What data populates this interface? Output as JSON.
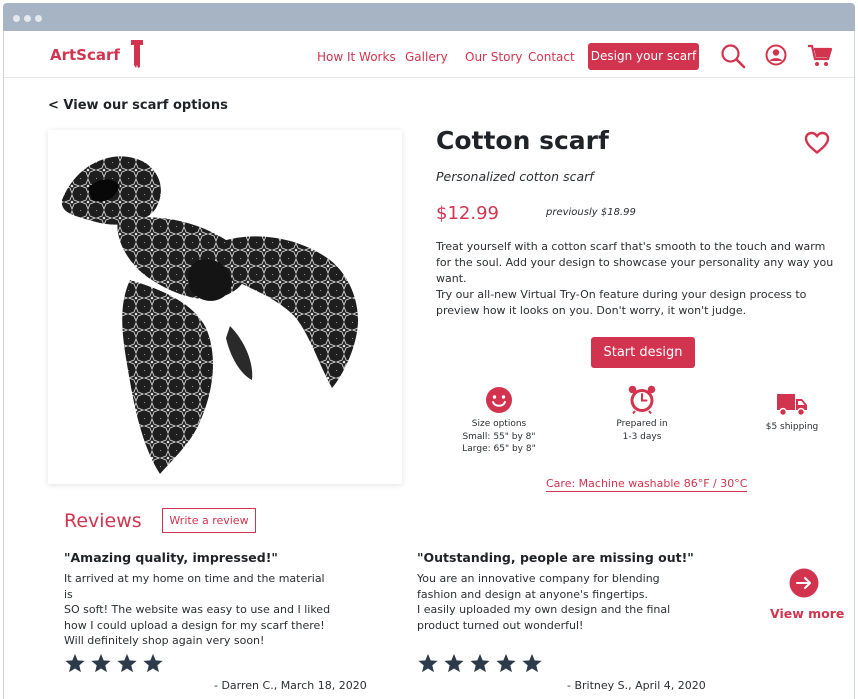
{
  "brand": {
    "name": "ArtScarf",
    "accent": "#d2344f"
  },
  "nav": {
    "links": [
      "How It Works",
      "Gallery",
      "Our Story",
      "Contact"
    ],
    "cta": "Design your scarf"
  },
  "back_link": "< View our scarf options",
  "product": {
    "title": "Cotton scarf",
    "subtitle": "Personalized cotton scarf",
    "price": "$12.99",
    "previous_price": "previously $18.99",
    "description_1": "Treat yourself with a cotton scarf that's smooth to the touch and warm for the soul. Add your design to showcase your personality any way you want.",
    "description_2": "Try our all-new Virtual Try-On feature during your design process to preview how it looks on you. Don't worry, it won't judge.",
    "start_button": "Start design",
    "features": [
      {
        "icon": "smile-icon",
        "lines": [
          "Size options",
          "Small: 55\" by 8\"",
          "Large: 65\" by 8\""
        ]
      },
      {
        "icon": "alarm-clock-icon",
        "lines": [
          "Prepared in",
          "1-3 days"
        ]
      },
      {
        "icon": "truck-icon",
        "lines": [
          "$5 shipping"
        ]
      }
    ],
    "care": "Care: Machine washable 86°F / 30°C"
  },
  "reviews": {
    "heading": "Reviews",
    "write_button": "Write a review",
    "items": [
      {
        "title": "\"Amazing quality, impressed!\"",
        "lines": [
          "It arrived at my home on time and the material is",
          "SO soft! The website was easy to use and I liked",
          "how I could upload a design for my scarf there!",
          "Will definitely shop again very soon!"
        ],
        "stars": 4,
        "author": "- Darren C., March 18, 2020"
      },
      {
        "title": "\"Outstanding, people are missing out!\"",
        "lines": [
          "You are an innovative company for blending",
          "fashion and design at anyone's fingertips.",
          "I easily uploaded my own design and the final",
          "product turned out wonderful!"
        ],
        "stars": 5,
        "author": "- Britney S., April 4, 2020"
      }
    ],
    "view_more": "View more"
  }
}
